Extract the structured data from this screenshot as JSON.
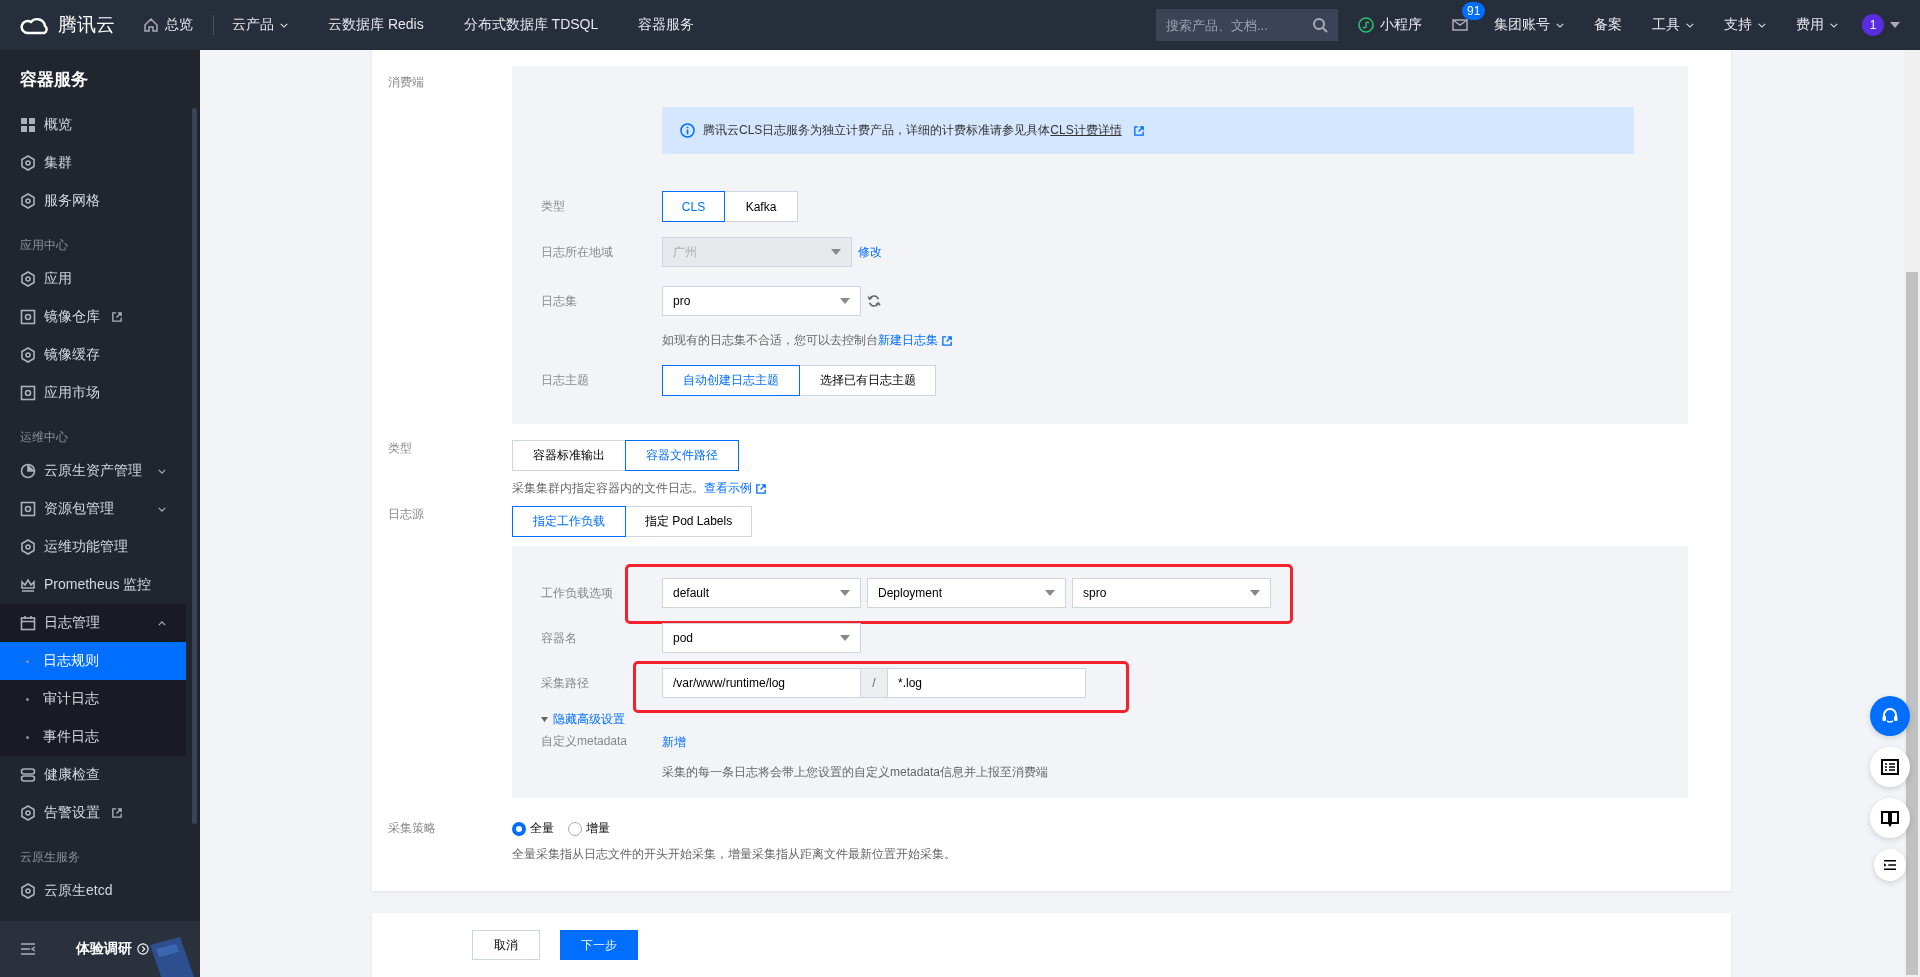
{
  "topbar": {
    "logo": "腾讯云",
    "nav": [
      {
        "label": "总览",
        "kind": "home"
      },
      {
        "label": "云产品",
        "kind": "dropdown"
      },
      {
        "label": "云数据库 Redis",
        "kind": "plain"
      },
      {
        "label": "分布式数据库 TDSQL",
        "kind": "plain"
      },
      {
        "label": "容器服务",
        "kind": "plain"
      }
    ],
    "search": {
      "placeholder": "搜索产品、文档..."
    },
    "right": [
      {
        "label": "小程序",
        "kind": "miniapp"
      },
      {
        "label": "91",
        "kind": "mail"
      },
      {
        "label": "集团账号",
        "kind": "dropdown"
      },
      {
        "label": "备案",
        "kind": "plain"
      },
      {
        "label": "工具",
        "kind": "dropdown"
      },
      {
        "label": "支持",
        "kind": "dropdown"
      },
      {
        "label": "费用",
        "kind": "dropdown"
      }
    ],
    "avatar": "1"
  },
  "sidebar": {
    "title": "容器服务",
    "items": [
      {
        "kind": "item",
        "label": "概览",
        "selected": false
      },
      {
        "kind": "item",
        "label": "集群",
        "selected": false
      },
      {
        "kind": "item",
        "label": "服务网格",
        "selected": false
      },
      {
        "kind": "group",
        "label": "应用中心"
      },
      {
        "kind": "item",
        "label": "应用",
        "selected": false
      },
      {
        "kind": "item",
        "label": "镜像仓库",
        "selected": false,
        "external": true
      },
      {
        "kind": "item",
        "label": "镜像缓存",
        "selected": false
      },
      {
        "kind": "item",
        "label": "应用市场",
        "selected": false
      },
      {
        "kind": "group",
        "label": "运维中心"
      },
      {
        "kind": "item",
        "label": "云原生资产管理",
        "selected": false,
        "expanded": false
      },
      {
        "kind": "item",
        "label": "资源包管理",
        "selected": false,
        "expanded": false
      },
      {
        "kind": "item",
        "label": "运维功能管理",
        "selected": false
      },
      {
        "kind": "item",
        "label": "Prometheus 监控",
        "selected": false
      },
      {
        "kind": "item",
        "label": "日志管理",
        "selected": false,
        "expanded": true,
        "children": [
          {
            "label": "日志规则",
            "selected": true
          },
          {
            "label": "审计日志",
            "selected": false
          },
          {
            "label": "事件日志",
            "selected": false
          }
        ]
      },
      {
        "kind": "item",
        "label": "健康检查",
        "selected": false
      },
      {
        "kind": "item",
        "label": "告警设置",
        "selected": false,
        "external": true
      },
      {
        "kind": "group",
        "label": "云原生服务"
      },
      {
        "kind": "item",
        "label": "云原生etcd",
        "selected": false
      }
    ],
    "footer": "体验调研"
  },
  "consumer": {
    "label": "消费端",
    "notice": "腾讯云CLS日志服务为独立计费产品，详细的计费标准请参见具体",
    "notice_link": "CLS计费详情",
    "type": {
      "label": "类型",
      "options": [
        {
          "label": "CLS",
          "selected": true
        },
        {
          "label": "Kafka",
          "selected": false
        }
      ]
    },
    "region": {
      "label": "日志所在地域",
      "value": "广州",
      "disabled": true,
      "action": "修改"
    },
    "logset": {
      "label": "日志集",
      "value": "pro",
      "hint": "如现有的日志集不合适，您可以去控制台",
      "hint_link": "新建日志集"
    },
    "topic": {
      "label": "日志主题",
      "options": [
        {
          "label": "自动创建日志主题",
          "selected": true
        },
        {
          "label": "选择已有日志主题",
          "selected": false
        }
      ]
    }
  },
  "type": {
    "label": "类型",
    "options": [
      {
        "label": "容器标准输出",
        "selected": false
      },
      {
        "label": "容器文件路径",
        "selected": true
      }
    ],
    "hint": "采集集群内指定容器内的文件日志。",
    "hint_link": "查看示例"
  },
  "source": {
    "label": "日志源",
    "options": [
      {
        "label": "指定工作负载",
        "selected": true
      },
      {
        "label": "指定 Pod Labels",
        "selected": false
      }
    ],
    "workload": {
      "label": "工作负载选项",
      "highlighted": true,
      "selects": [
        "default",
        "Deployment",
        "spro"
      ]
    },
    "container": {
      "label": "容器名",
      "value": "pod"
    },
    "path": {
      "label": "采集路径",
      "highlighted": true,
      "directory": "/var/www/runtime/log",
      "separator": "/",
      "file": "*.log"
    },
    "advanced": {
      "label": "隐藏高级设置",
      "expanded": true
    },
    "metadata": {
      "label": "自定义metadata",
      "action": "新增",
      "hint": "采集的每一条日志将会带上您设置的自定义metadata信息并上报至消费端"
    }
  },
  "strategy": {
    "label": "采集策略",
    "options": [
      {
        "label": "全量",
        "selected": true
      },
      {
        "label": "增量",
        "selected": false
      }
    ],
    "hint": "全量采集指从日志文件的开头开始采集，增量采集指从距离文件最新位置开始采集。"
  },
  "footer": {
    "buttons": [
      {
        "label": "取消",
        "kind": "secondary"
      },
      {
        "label": "下一步",
        "kind": "primary"
      }
    ]
  }
}
